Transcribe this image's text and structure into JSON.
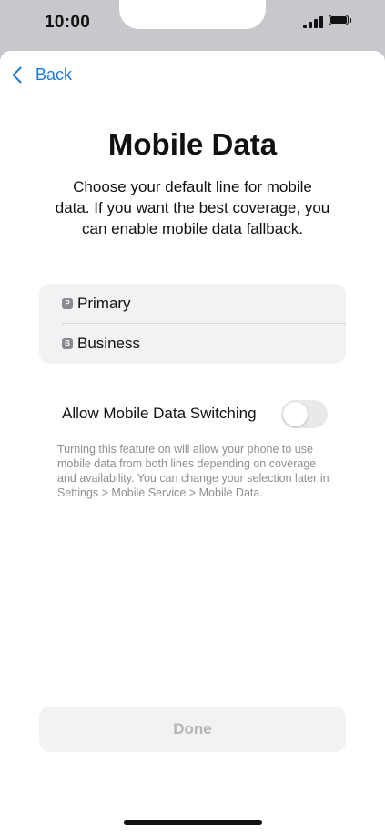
{
  "status_bar": {
    "time": "10:00",
    "icons": [
      "signal-icon",
      "battery-icon"
    ]
  },
  "nav": {
    "back_label": "Back"
  },
  "header": {
    "title": "Mobile Data",
    "subtitle": "Choose your default line for mobile data. If you want the best coverage, you can enable mobile data fallback."
  },
  "lines": [
    {
      "badge": "P",
      "label": "Primary"
    },
    {
      "badge": "B",
      "label": "Business"
    }
  ],
  "switching": {
    "label": "Allow Mobile Data Switching",
    "enabled": false,
    "footnote": "Turning this feature on will allow your phone to use mobile data from both lines depending on coverage and availability. You can change your selection later in Settings > Mobile Service > Mobile Data."
  },
  "footer": {
    "done_label": "Done"
  },
  "colors": {
    "accent": "#1a7ad8",
    "status_bar_bg": "#c8c8cc",
    "group_bg": "#f2f2f4",
    "footnote_text": "#8e8e93",
    "disabled_text": "#b5b5b8"
  }
}
